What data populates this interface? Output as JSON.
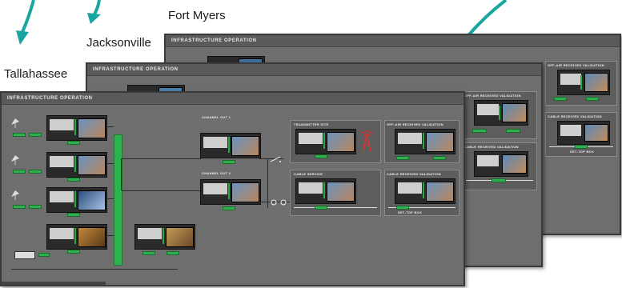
{
  "cities": {
    "tallahassee": "Tallahassee",
    "jacksonville": "Jacksonville",
    "fort_myers": "Fort Myers"
  },
  "windows": {
    "front": {
      "title": "INFRASTRUCTURE OPERATION",
      "sections": {
        "channel_out_1": "CHANNEL OUT 1",
        "channel_out_2": "CHANNEL OUT 2",
        "transmitter_site": "TRANSMITTER SITE",
        "off_air": "OFF-AIR RECEIVED VALIDATION",
        "cable_service": "CABLE SERVICE",
        "cable_received": "CABLE RECEIVED VALIDATION",
        "set_top_box": "SET-TOP BOX"
      }
    },
    "middle": {
      "title": "INFRASTRUCTURE OPERATION",
      "sections": {
        "off_air": "OFF-AIR RECEIVED VALIDATION",
        "cable_received": "CABLE RECEIVED VALIDATION"
      }
    },
    "back": {
      "title": "INFRASTRUCTURE OPERATION",
      "sections": {
        "off_air": "OFF-AIR RECEIVED VALIDATION",
        "cable_received": "CABLE RECEIVED VALIDATION",
        "set_top_box": "SET-TOP BOX"
      }
    }
  },
  "colors": {
    "arrow": "#1aa6a0",
    "window_bg": "#6e6e6e",
    "status_green": "#2fb04f"
  },
  "icons": [
    "satellite-dish-icon",
    "broadcast-tower-icon",
    "arrow-down-icon",
    "monitor-icon"
  ]
}
